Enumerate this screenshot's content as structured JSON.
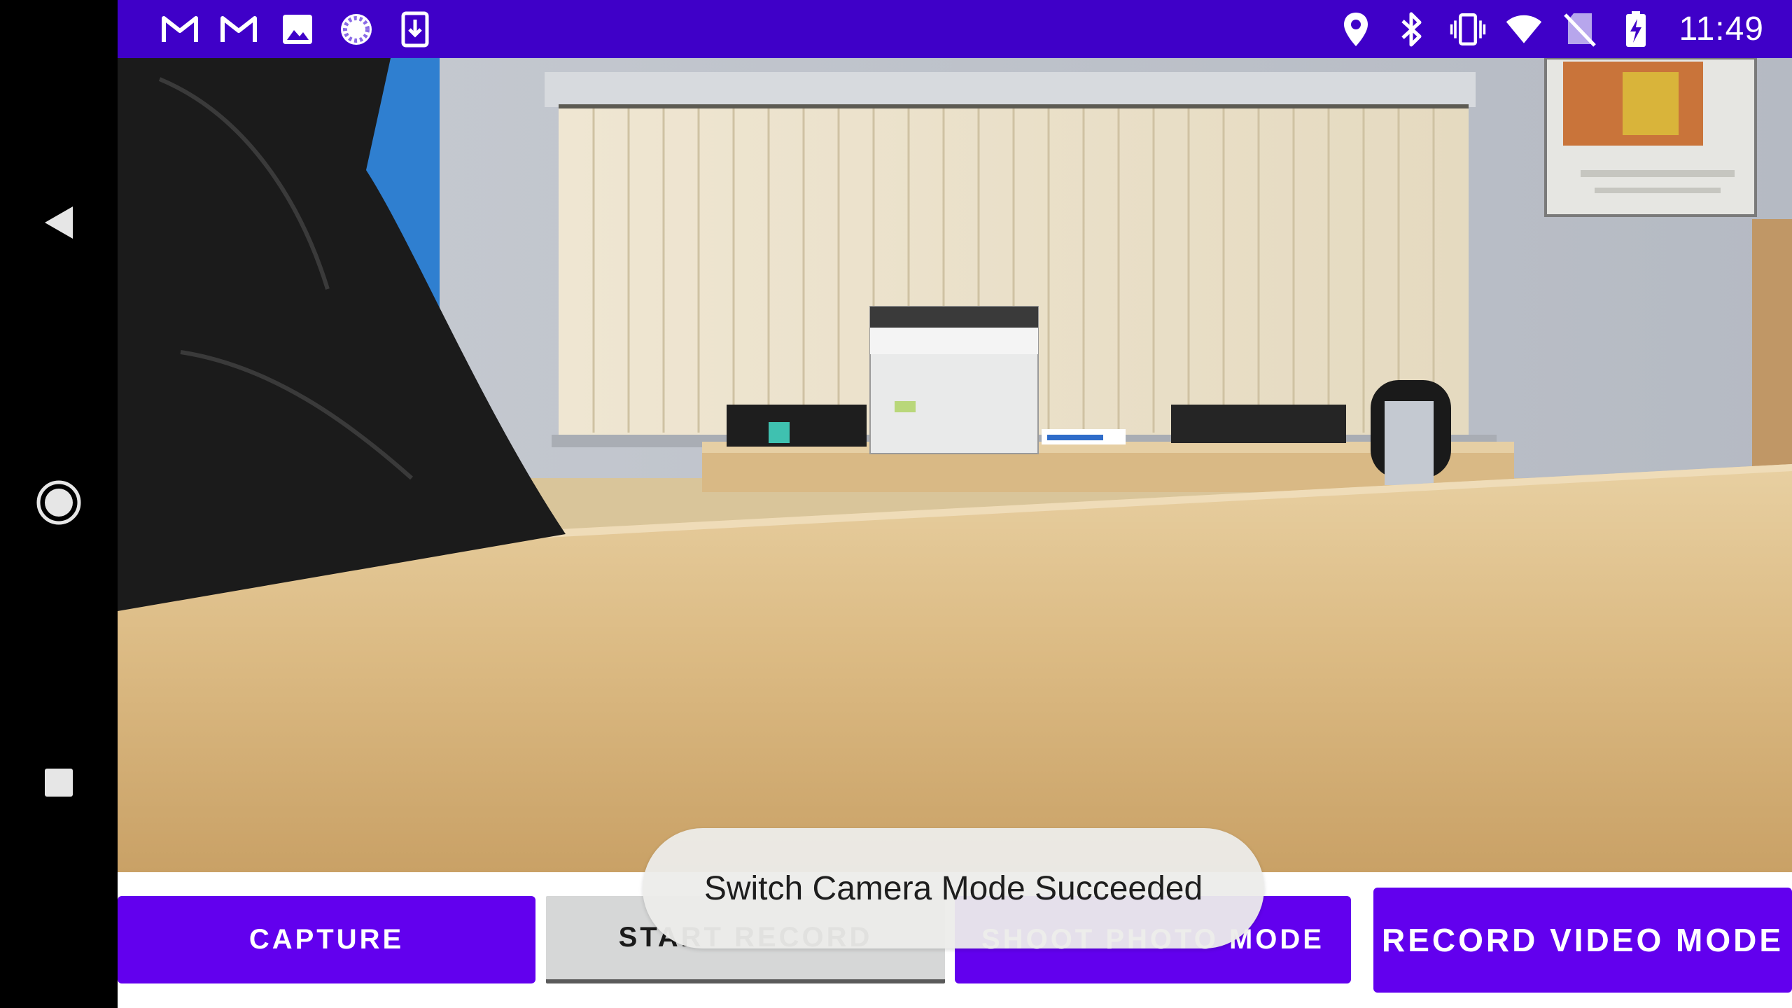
{
  "status_bar": {
    "time": "11:49",
    "background": "#3F00C8",
    "left_icons": [
      "gmail-icon",
      "gmail-icon",
      "image-icon",
      "sync-icon",
      "download-icon"
    ],
    "right_icons": [
      "location-icon",
      "bluetooth-icon",
      "vibrate-icon",
      "wifi-icon",
      "no-sim-icon",
      "battery-charging-icon"
    ]
  },
  "navigation": {
    "back": "back-icon",
    "home": "home-icon",
    "recents": "recents-icon"
  },
  "preview": {
    "content": "camera-live-view"
  },
  "buttons": {
    "capture": "CAPTURE",
    "start_record": "START RECORD",
    "shoot_photo_mode": "SHOOT PHOTO MODE",
    "record_video_mode": "RECORD VIDEO MODE"
  },
  "toast": {
    "message": "Switch Camera Mode Succeeded"
  },
  "colors": {
    "accent": "#6200EE",
    "status_bar": "#3F00C8",
    "secondary_button": "#d6d7d7"
  }
}
